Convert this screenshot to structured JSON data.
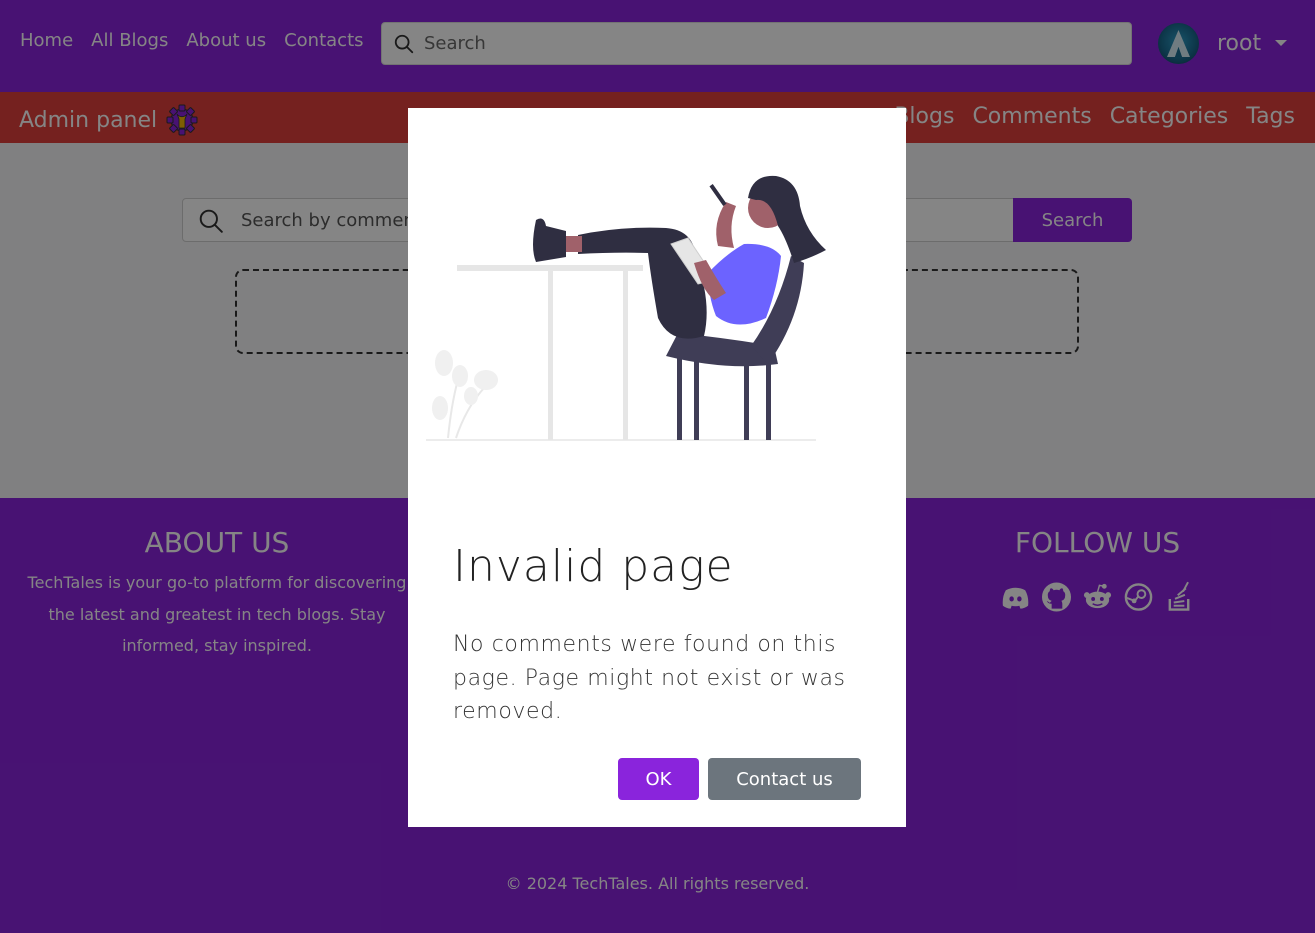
{
  "nav": {
    "links": [
      "Home",
      "All Blogs",
      "About us",
      "Contacts"
    ],
    "search_placeholder": "Search",
    "user": "root"
  },
  "admin": {
    "title": "Admin panel",
    "links": [
      "Blogs",
      "Comments",
      "Categories",
      "Tags"
    ]
  },
  "main": {
    "search_placeholder": "Search by comment",
    "search_button": "Search"
  },
  "footer": {
    "about_title": "ABOUT US",
    "about_text": "TechTales is your go-to platform for discovering the latest and greatest in tech blogs. Stay informed, stay inspired.",
    "follow_title": "FOLLOW US",
    "socials": [
      "discord-icon",
      "github-icon",
      "reddit-icon",
      "steam-icon",
      "stack-overflow-icon"
    ],
    "copyright": "© 2024 TechTales. All rights reserved."
  },
  "modal": {
    "title": "Invalid page",
    "text": "No comments were found on this page. Page might not exist or was removed.",
    "ok": "OK",
    "contact": "Contact us"
  },
  "colors": {
    "primary": "#8a24dc",
    "admin_bar": "#e0403c",
    "secondary_button": "#6c757d",
    "illustration_accent": "#6c63ff"
  }
}
